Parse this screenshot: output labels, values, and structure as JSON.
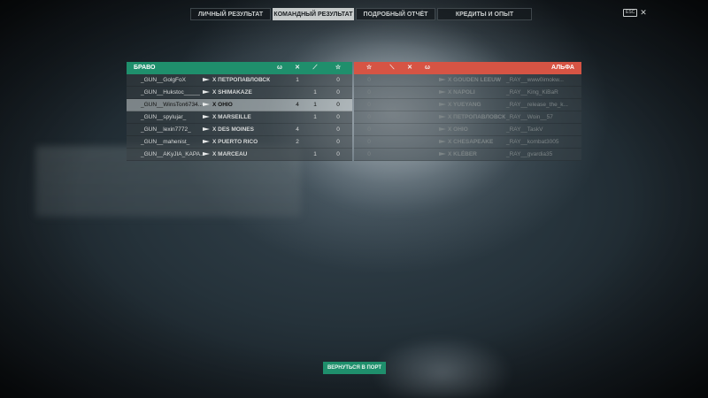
{
  "tabs": [
    {
      "label": "ЛИЧНЫЙ РЕЗУЛЬТАТ"
    },
    {
      "label": "КОМАНДНЫЙ РЕЗУЛЬТАТ"
    },
    {
      "label": "ПОДРОБНЫЙ ОТЧЁТ"
    },
    {
      "label": "КРЕДИТЫ И ОПЫТ"
    }
  ],
  "active_tab": "КОМАНДНЫЙ РЕЗУЛЬТАТ",
  "esc_label": "ESC",
  "colors": {
    "ally": "#1f8f6c",
    "enemy": "#d65444"
  },
  "left_team": {
    "name": "БРАВО",
    "columns": [
      "planes-shot-icon",
      "kills-icon",
      "ship-icon",
      "star-icon"
    ],
    "rows": [
      {
        "player": "_GUN__GolgFoX",
        "tier": "X",
        "ship": "ПЕТРОПАВЛОВСК",
        "c1": "1",
        "c2": "",
        "c3": "",
        "c4": "0"
      },
      {
        "player": "_GUN__Hukstoc_____",
        "tier": "X",
        "ship": "SHIMAKAZE",
        "c1": "",
        "c2": "",
        "c3": "1",
        "c4": "0"
      },
      {
        "player": "_GUN__WinsTon6734...",
        "tier": "X",
        "ship": "OHIO",
        "c1": "4",
        "c2": "",
        "c3": "1",
        "c4": "0"
      },
      {
        "player": "_GUN__spylujar_",
        "tier": "X",
        "ship": "MARSEILLE",
        "c1": "",
        "c2": "",
        "c3": "1",
        "c4": "0"
      },
      {
        "player": "_GUN__lexin7772_",
        "tier": "X",
        "ship": "DES MOINES",
        "c1": "4",
        "c2": "",
        "c3": "",
        "c4": "0"
      },
      {
        "player": "_GUN__mahenist_",
        "tier": "X",
        "ship": "PUERTO RICO",
        "c1": "2",
        "c2": "",
        "c3": "",
        "c4": "0"
      },
      {
        "player": "_GUN__AKyJIA_KAPA...",
        "tier": "X",
        "ship": "MARCEAU",
        "c1": "",
        "c2": "",
        "c3": "1",
        "c4": "0"
      }
    ]
  },
  "right_team": {
    "name": "АЛЬФА",
    "columns": [
      "star-icon",
      "ship-icon",
      "kills-icon",
      "planes-shot-icon"
    ],
    "rows": [
      {
        "player": "_RAY__www0imokw...",
        "tier": "X",
        "ship": "GOUDEN LEEUW",
        "score": "0"
      },
      {
        "player": "_RAY__King_KiBaR",
        "tier": "X",
        "ship": "NAPOLI",
        "score": "0"
      },
      {
        "player": "_RAY__release_the_k...",
        "tier": "X",
        "ship": "YUEYANG",
        "score": "0"
      },
      {
        "player": "_RAY__Woin__57",
        "tier": "X",
        "ship": "ПЕТРОПАВЛОВСК",
        "score": "0"
      },
      {
        "player": "_RAY__TaskV",
        "tier": "X",
        "ship": "OHIO",
        "score": "0"
      },
      {
        "player": "_RAY__kombat3005",
        "tier": "X",
        "ship": "CHESAPEAKE",
        "score": "0"
      },
      {
        "player": "_RAY__gvardia35",
        "tier": "X",
        "ship": "KLÉBER",
        "score": "0"
      }
    ]
  },
  "port_button": "ВЕРНУТЬСЯ В ПОРТ"
}
